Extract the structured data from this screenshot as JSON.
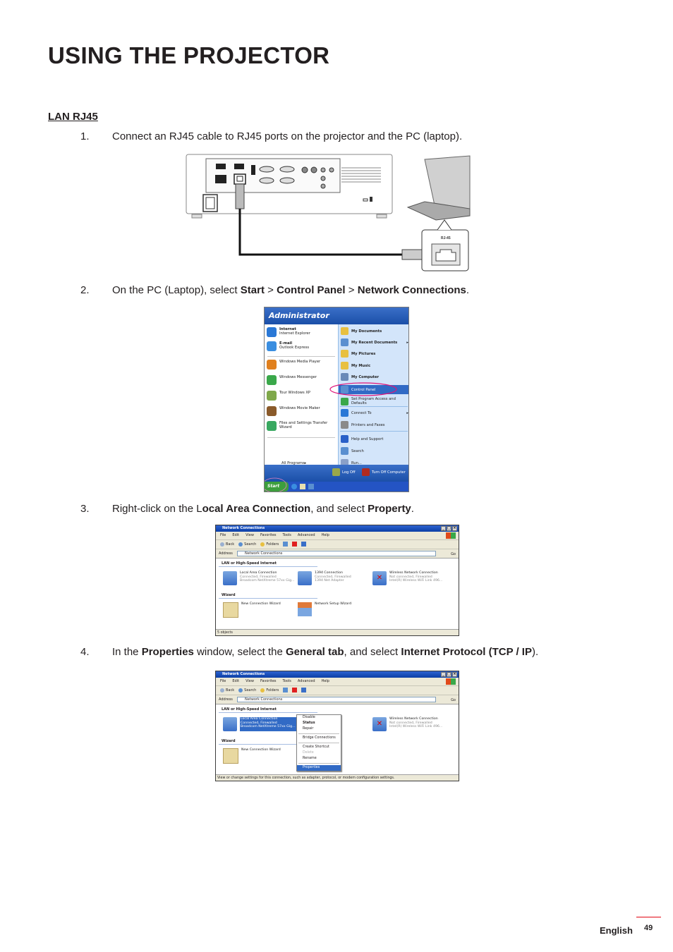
{
  "page": {
    "title": "USING THE PROJECTOR",
    "section_heading": "LAN RJ45"
  },
  "steps": [
    {
      "num": "1.",
      "parts": [
        {
          "t": "Connect an RJ45 cable to RJ45 ports on the projector and the PC (laptop).",
          "b": false
        }
      ]
    },
    {
      "num": "2.",
      "parts": [
        {
          "t": "On the PC (Laptop), select ",
          "b": false
        },
        {
          "t": "Start",
          "b": true
        },
        {
          "t": " > ",
          "b": false
        },
        {
          "t": "Control Panel",
          "b": true
        },
        {
          "t": " > ",
          "b": false
        },
        {
          "t": "Network Connections",
          "b": true
        },
        {
          "t": ".",
          "b": false
        }
      ]
    },
    {
      "num": "3.",
      "parts": [
        {
          "t": "Right-click on the L",
          "b": false
        },
        {
          "t": "ocal Area Connection",
          "b": true
        },
        {
          "t": ", and select ",
          "b": false
        },
        {
          "t": "Property",
          "b": true
        },
        {
          "t": ".",
          "b": false
        }
      ]
    },
    {
      "num": "4.",
      "parts": [
        {
          "t": "In the ",
          "b": false
        },
        {
          "t": "Properties",
          "b": true
        },
        {
          "t": " window, select the ",
          "b": false
        },
        {
          "t": "General tab",
          "b": true
        },
        {
          "t": ", and select ",
          "b": false
        },
        {
          "t": "Internet Protocol (TCP / IP",
          "b": true
        },
        {
          "t": ").",
          "b": false
        }
      ]
    }
  ],
  "diagram": {
    "callout_label": "RJ-45"
  },
  "start_menu": {
    "user": "Administrator",
    "left_items": [
      {
        "title": "Internet",
        "sub": "Internet Explorer",
        "color": "#2a78d6"
      },
      {
        "title": "E-mail",
        "sub": "Outlook Express",
        "color": "#3a8ee0"
      },
      {
        "title": "Windows Media Player",
        "sub": "",
        "color": "#e0801e"
      },
      {
        "title": "Windows Messenger",
        "sub": "",
        "color": "#3aa84a"
      },
      {
        "title": "Tour Windows XP",
        "sub": "",
        "color": "#7fa84a"
      },
      {
        "title": "Windows Movie Maker",
        "sub": "",
        "color": "#8a5a2a"
      },
      {
        "title": "Files and Settings Transfer Wizard",
        "sub": "",
        "color": "#38a860"
      }
    ],
    "all_programs": "All Programs",
    "right_items": [
      {
        "label": "My Documents",
        "bold": true,
        "arrow": false,
        "color": "#e8c040"
      },
      {
        "label": "My Recent Documents",
        "bold": true,
        "arrow": true,
        "color": "#5a8fd0"
      },
      {
        "label": "My Pictures",
        "bold": true,
        "arrow": false,
        "color": "#e8c040"
      },
      {
        "label": "My Music",
        "bold": true,
        "arrow": false,
        "color": "#e8c040"
      },
      {
        "label": "My Computer",
        "bold": true,
        "arrow": false,
        "color": "#6a8ab8"
      },
      {
        "label": "Control Panel",
        "bold": false,
        "arrow": false,
        "color": "#5a8fd0",
        "selected": true
      },
      {
        "label": "Set Program Access and Defaults",
        "bold": false,
        "arrow": false,
        "color": "#3aa84a"
      },
      {
        "label": "Connect To",
        "bold": false,
        "arrow": true,
        "color": "#2a78d6"
      },
      {
        "label": "Printers and Faxes",
        "bold": false,
        "arrow": false,
        "color": "#8a8a8a"
      },
      {
        "label": "Help and Support",
        "bold": false,
        "arrow": false,
        "color": "#2a60c8"
      },
      {
        "label": "Search",
        "bold": false,
        "arrow": false,
        "color": "#5a8fd0"
      },
      {
        "label": "Run...",
        "bold": false,
        "arrow": false,
        "color": "#8aa0c8"
      }
    ],
    "log_off": "Log Off",
    "turn_off": "Turn Off Computer",
    "start_label": "Start",
    "highlight_color": "#e0157a"
  },
  "nc_window_1": {
    "title": "Network Connections",
    "menu": [
      "File",
      "Edit",
      "View",
      "Favorites",
      "Tools",
      "Advanced",
      "Help"
    ],
    "toolbar": [
      "Back",
      "Search",
      "Folders"
    ],
    "address_label": "Address",
    "address_value": "Network Connections",
    "go_label": "Go",
    "group_lan": "LAN or High-Speed Internet",
    "connections": [
      {
        "name": "Local Area Connection",
        "status": "Connected, Firewalled",
        "device": "Broadcom NetXtreme 57xx Gig..."
      },
      {
        "name": "1394 Connection",
        "status": "Connected, Firewalled",
        "device": "1394 Net Adapter"
      },
      {
        "name": "Wireless Network Connection",
        "status": "Not connected, Firewalled",
        "device": "Intel(R) Wireless WiFi Link 496..."
      }
    ],
    "group_wizard": "Wizard",
    "wizards": [
      "New Connection Wizard",
      "Network Setup Wizard"
    ],
    "status_bar": "5 objects"
  },
  "nc_window_2": {
    "title": "Network Connections",
    "menu": [
      "File",
      "Edit",
      "View",
      "Favorites",
      "Tools",
      "Advanced",
      "Help"
    ],
    "toolbar": [
      "Back",
      "Search",
      "Folders"
    ],
    "address_label": "Address",
    "address_value": "Network Connections",
    "go_label": "Go",
    "group_lan": "LAN or High-Speed Internet",
    "connections": [
      {
        "name": "Local Area Connection",
        "status": "Connected, Firewalled",
        "device": "Broadcom NetXtreme 57xx Gig..."
      },
      {
        "name": "Wireless Network Connection",
        "status": "Not connected, Firewalled",
        "device": "Intel(R) Wireless WiFi Link 496..."
      }
    ],
    "group_wizard": "Wizard",
    "wizards": [
      "New Connection Wizard"
    ],
    "context_menu": [
      {
        "label": "Disable",
        "style": ""
      },
      {
        "label": "Status",
        "style": "bold"
      },
      {
        "label": "Repair",
        "style": ""
      },
      {
        "sep": true
      },
      {
        "label": "Bridge Connections",
        "style": ""
      },
      {
        "sep": true
      },
      {
        "label": "Create Shortcut",
        "style": ""
      },
      {
        "label": "Delete",
        "style": "dis"
      },
      {
        "label": "Rename",
        "style": ""
      },
      {
        "sep": true
      },
      {
        "label": "Properties",
        "style": "sel"
      }
    ],
    "status_bar": "View or change settings for this connection, such as adapter, protocol, or modem configuration settings."
  },
  "footer": {
    "language": "English",
    "page_number": "49",
    "accent_color": "#e30613"
  }
}
